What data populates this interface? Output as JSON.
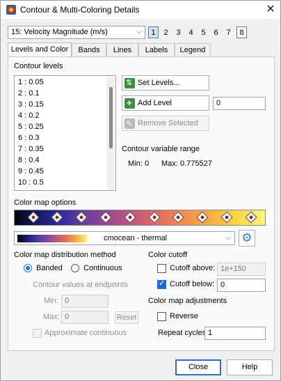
{
  "window": {
    "title": "Contour & Multi-Coloring Details",
    "close_glyph": "✕"
  },
  "variable": {
    "selected": "15: Velocity Magnitude (m/s)",
    "chevron": "⌵"
  },
  "frames": [
    "1",
    "2",
    "3",
    "4",
    "5",
    "6",
    "7",
    "8"
  ],
  "tabs": [
    "Levels and Color",
    "Bands",
    "Lines",
    "Labels",
    "Legend"
  ],
  "levels": {
    "header": "Contour levels",
    "items": [
      "1 : 0.05",
      "2 : 0.1",
      "3 : 0.15",
      "4 : 0.2",
      "5 : 0.25",
      "6 : 0.3",
      "7 : 0.35",
      "8 : 0.4",
      "9 : 0.45",
      "10 : 0.5"
    ],
    "set_levels": "Set Levels...",
    "add_level": "Add Level",
    "add_level_value": "0",
    "remove_selected": "Remove Selected"
  },
  "range": {
    "header": "Contour variable range",
    "min_label": "Min:",
    "min_value": "0",
    "max_label": "Max:",
    "max_value": "0.775527"
  },
  "colormap": {
    "header": "Color map options",
    "name": "cmocean - thermal",
    "chevron": "⌵",
    "gear": "⚙",
    "end_gear": "✲"
  },
  "distribution": {
    "header": "Color map distribution method",
    "banded": "Banded",
    "continuous": "Continuous",
    "endpoints_header": "Contour values at endpoints",
    "min_label": "Min:",
    "min_value": "0",
    "max_label": "Max:",
    "max_value": "0",
    "reset": "Reset",
    "approx": "Approximate continuous"
  },
  "cutoff": {
    "header": "Color cutoff",
    "above_label": "Cutoff above:",
    "above_value": "1e+150",
    "below_label": "Cutoff below:",
    "below_value": "0"
  },
  "adjust": {
    "header": "Color map adjustments",
    "reverse": "Reverse",
    "cycles_label": "Repeat cycles:",
    "cycles_value": "1"
  },
  "footer": {
    "close": "Close",
    "help": "Help"
  },
  "colors": {
    "accent": "#1f6fd1",
    "dialog_bg": "#f0f0f0"
  }
}
